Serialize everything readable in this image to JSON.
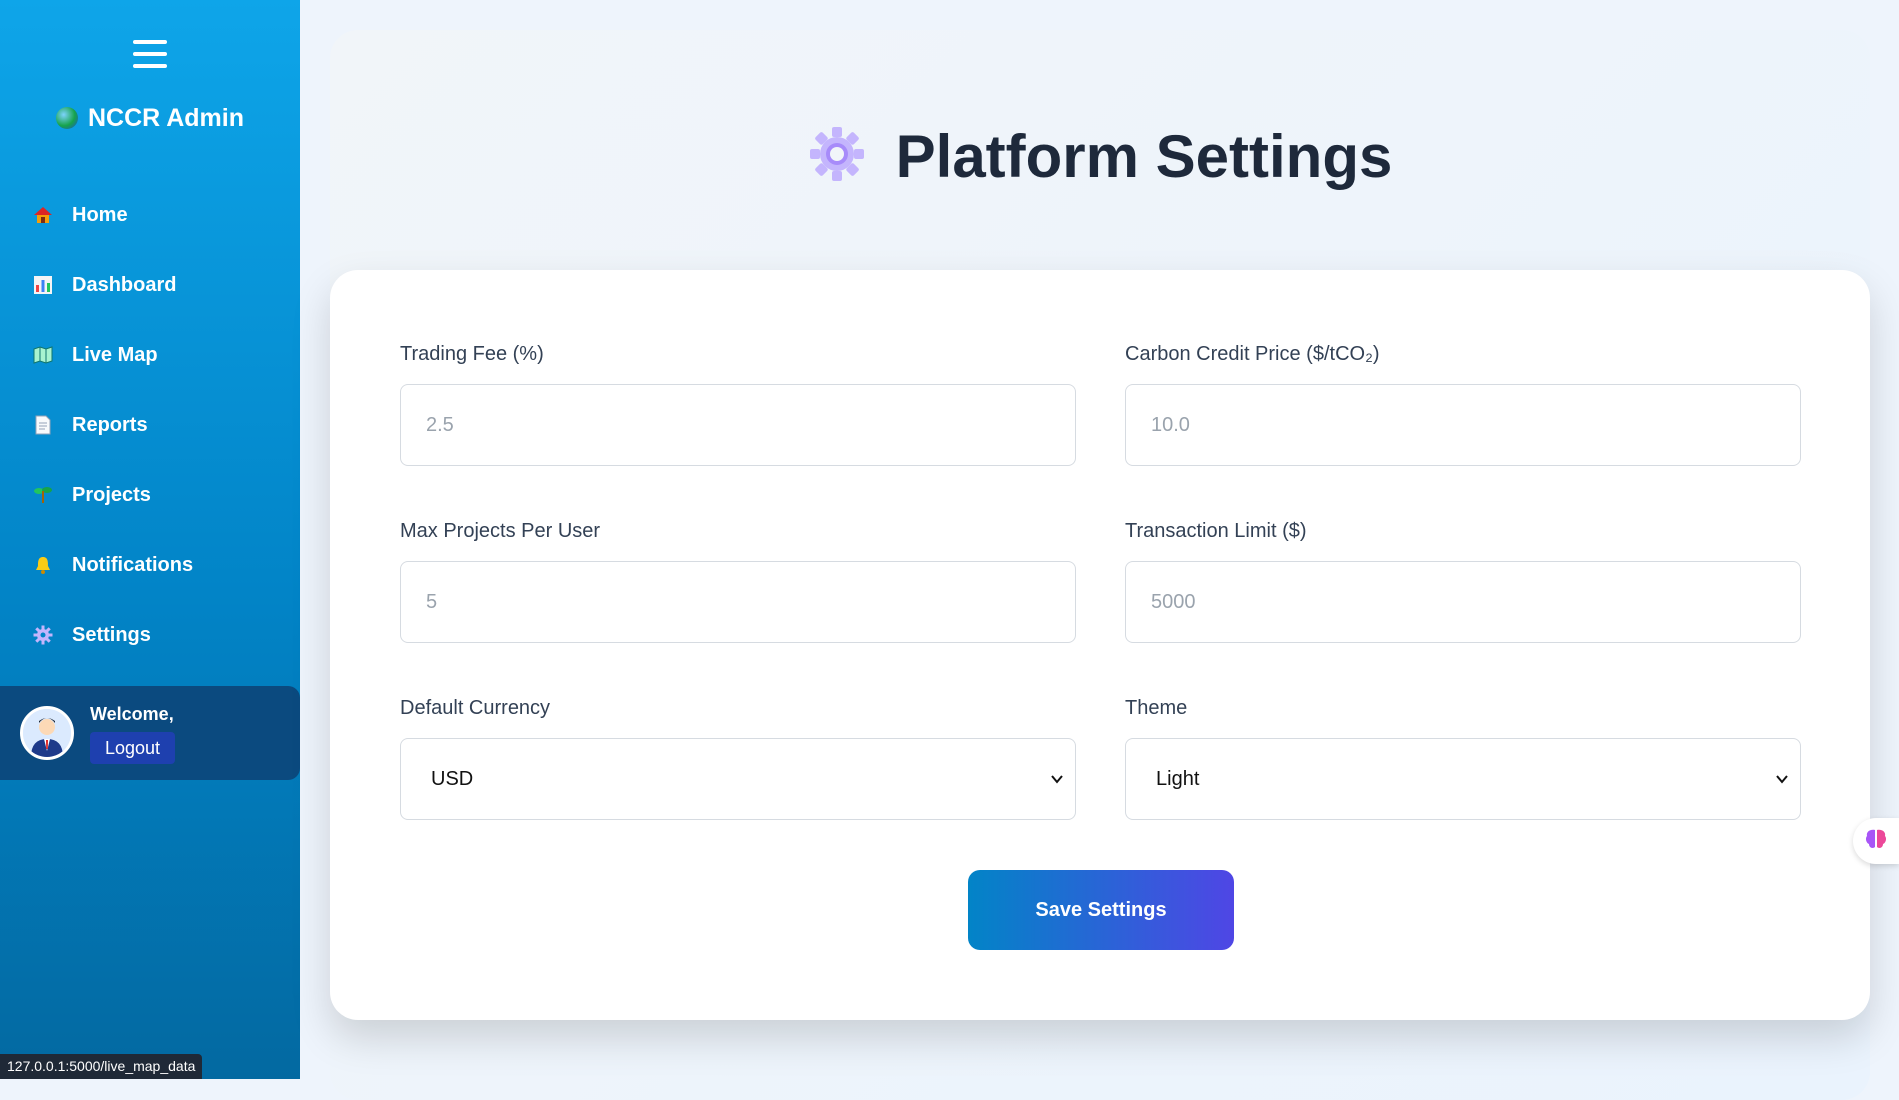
{
  "sidebar": {
    "brand": "NCCR Admin",
    "items": [
      {
        "label": "Home"
      },
      {
        "label": "Dashboard"
      },
      {
        "label": "Live Map"
      },
      {
        "label": "Reports"
      },
      {
        "label": "Projects"
      },
      {
        "label": "Notifications"
      },
      {
        "label": "Settings"
      }
    ],
    "welcome": "Welcome,",
    "logout": "Logout"
  },
  "status_url": "127.0.0.1:5000/live_map_data",
  "page": {
    "title": "Platform Settings"
  },
  "form": {
    "trading_fee": {
      "label": "Trading Fee (%)",
      "placeholder": "2.5"
    },
    "carbon_price": {
      "label": "Carbon Credit Price ($/tCO₂)",
      "placeholder": "10.0"
    },
    "max_projects": {
      "label": "Max Projects Per User",
      "placeholder": "5"
    },
    "transaction_limit": {
      "label": "Transaction Limit ($)",
      "placeholder": "5000"
    },
    "default_currency": {
      "label": "Default Currency",
      "value": "USD"
    },
    "theme": {
      "label": "Theme",
      "value": "Light"
    },
    "save_label": "Save Settings"
  },
  "colors": {
    "sidebar_top": "#0ea5e9",
    "sidebar_bottom": "#0369a1",
    "button_start": "#0284c7",
    "button_end": "#4f46e5",
    "title": "#1e293b"
  }
}
